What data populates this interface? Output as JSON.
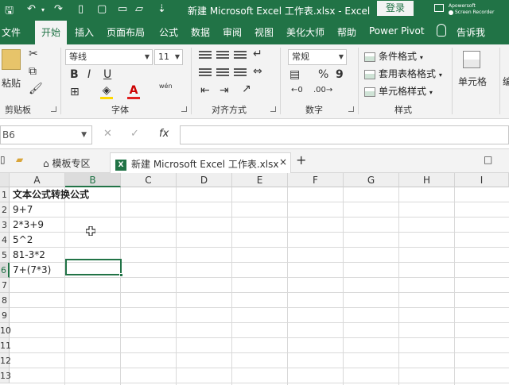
{
  "titlebar": {
    "title": "新建 Microsoft Excel 工作表.xlsx  -  Excel",
    "login": "登录",
    "recorder": "Screen Recorder",
    "recorder_brand": "Apowersoft"
  },
  "menu_tabs": [
    "文件",
    "开始",
    "插入",
    "页面布局",
    "公式",
    "数据",
    "审阅",
    "视图",
    "美化大师",
    "帮助",
    "Power Pivot",
    "告诉我"
  ],
  "ribbon": {
    "paste_label": "粘贴",
    "clipboard_label": "剪贴板",
    "font_name": "等线",
    "font_size": "11",
    "font_label": "字体",
    "bold": "B",
    "italic": "I",
    "underline": "U",
    "wen": "wén",
    "align_label": "对齐方式",
    "number_format": "常规",
    "number_label": "数字",
    "percent": "%",
    "comma": "9",
    "cond_format": "条件格式",
    "table_format": "套用表格格式",
    "cell_style": "单元格样式",
    "styles_label": "样式",
    "cells_label": "单元格",
    "edit_label": "编"
  },
  "formula_bar": {
    "name_box": "B6",
    "cancel": "✕",
    "confirm": "✓",
    "fx": "fx",
    "value": ""
  },
  "doc_tabs": {
    "template_tab": "模板专区",
    "file_tab": "新建 Microsoft Excel 工作表.xlsx",
    "close": "×",
    "add": "+",
    "right_label": "□"
  },
  "grid": {
    "columns": [
      "A",
      "B",
      "C",
      "D",
      "E",
      "F",
      "G",
      "H",
      "I"
    ],
    "rows": [
      "1",
      "2",
      "3",
      "4",
      "5",
      "6",
      "7",
      "8",
      "9",
      "10",
      "11",
      "12",
      "13"
    ],
    "column_a": [
      "文本公式转换公式",
      "9+7",
      "2*3+9",
      "5^2",
      "81-3*2",
      "7+(7*3)"
    ],
    "selected_cell": "B6"
  }
}
